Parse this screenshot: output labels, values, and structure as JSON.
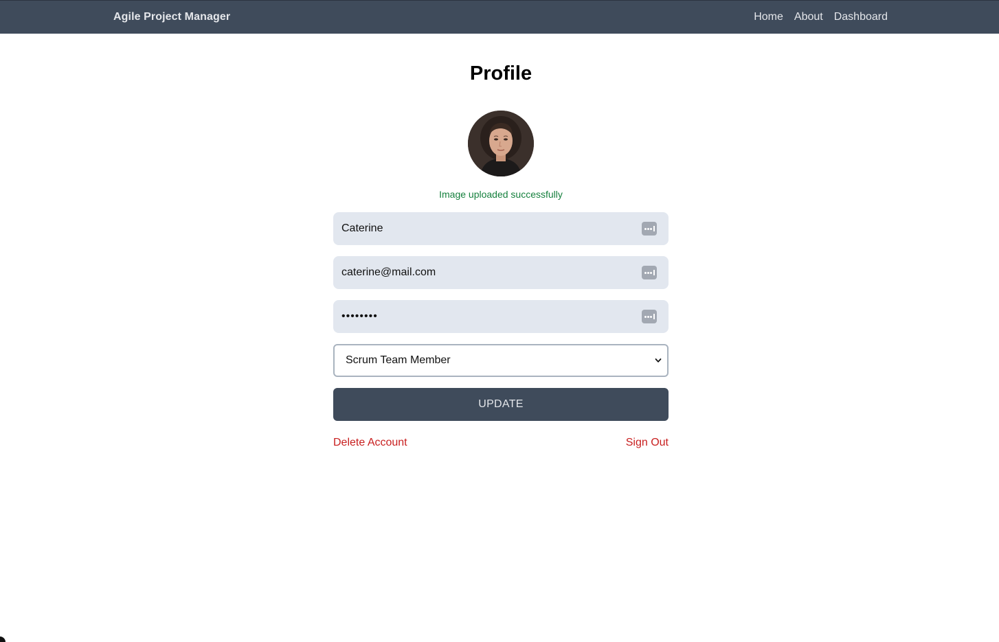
{
  "header": {
    "brand": "Agile Project Manager",
    "nav": [
      "Home",
      "About",
      "Dashboard"
    ]
  },
  "profile": {
    "title": "Profile",
    "upload_message": "Image uploaded successfully",
    "name_value": "Caterine",
    "email_value": "caterine@mail.com",
    "password_mask": "••••••••",
    "role_selected": "Scrum Team Member",
    "update_label": "UPDATE",
    "delete_label": "Delete Account",
    "signout_label": "Sign Out"
  },
  "colors": {
    "header_bg": "#3f4b5b",
    "input_bg": "#e2e7ef",
    "success": "#15803d",
    "danger": "#c81e1e"
  },
  "icons": {
    "field_icon": "password-manager-key-icon",
    "select_icon": "chevron-down-icon"
  }
}
